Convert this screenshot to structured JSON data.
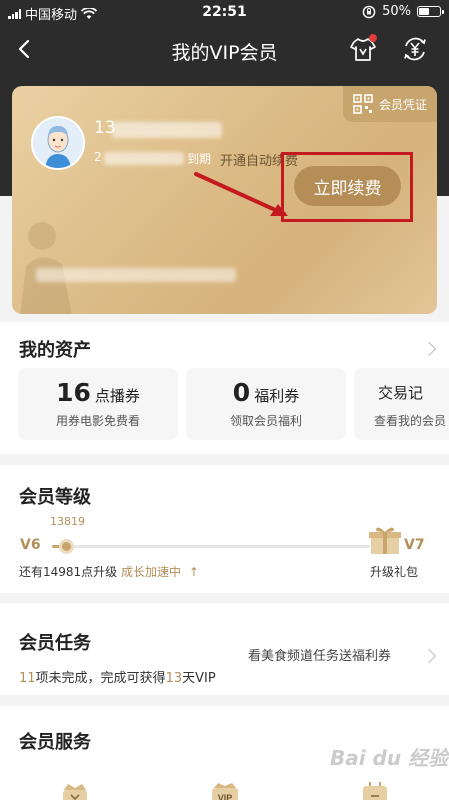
{
  "status_bar": {
    "carrier": "中国移动",
    "time": "22:51",
    "battery_text": "50%",
    "battery_level": 0.5
  },
  "nav": {
    "title": "我的VIP会员",
    "back_icon": "back-arrow-icon",
    "shirt_icon": "tshirt-icon",
    "coin_icon": "yuan-exchange-icon"
  },
  "vip_card": {
    "badge_label": "会员凭证",
    "name_visible": "13",
    "date_visible_prefix": "2",
    "date_visible_suffix": "到期",
    "auto_renew_label": "开通自动续费",
    "renew_button_label": "立即续费",
    "colors": {
      "gold": "#b58e57",
      "highlight_box": "#c3191f"
    }
  },
  "assets": {
    "title": "我的资产",
    "items": [
      {
        "number": "16",
        "unit": "点播券",
        "sub": "用券电影免费看"
      },
      {
        "number": "0",
        "unit": "福利券",
        "sub": "领取会员福利"
      },
      {
        "number": "",
        "unit": "交易记",
        "sub": "查看我的会员"
      }
    ]
  },
  "level": {
    "title": "会员等级",
    "current": "V6",
    "next": "V7",
    "points": "13819",
    "progress": 0.04,
    "note_prefix": "还有14981点升级",
    "note_accent": "成长加速中",
    "note_arrow": "↑",
    "gift_label": "升级礼包"
  },
  "tasks": {
    "title": "会员任务",
    "count": "11",
    "mid_text": "项未完成，完成可获得",
    "days": "13",
    "suffix": "天VIP",
    "promo": "看美食频道任务送福利券"
  },
  "service": {
    "title": "会员服务"
  },
  "watermark": "Bai du 经验"
}
